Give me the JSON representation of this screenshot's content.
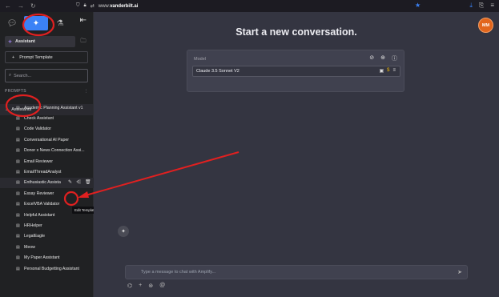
{
  "browser": {
    "url_prefix": "www.",
    "url_domain": "vanderbilt.ai"
  },
  "sidebar": {
    "assistant_label": "Assistant",
    "prompt_template_label": "Prompt Template",
    "search_placeholder": "Search...",
    "prompts_header": "PROMPTS",
    "folder_name": "Assistants",
    "items": [
      "Academic Planning Assistant v1",
      "Check Assistant",
      "Code Validator",
      "Conversational AI Paper",
      "Donor x News Connection Assi...",
      "Email Reviewer",
      "EmailThreadAnalyst",
      "Enthusiastic Assista",
      "Essay Reviewer",
      "ExcelVBA Validator",
      "Helpful Assistant",
      "HRHelper",
      "LegalEagle",
      "Meow",
      "My Paper Assistant",
      "Personal Budgetting Assistant"
    ],
    "tooltip": "Edit Template"
  },
  "main": {
    "title": "Start a new conversation.",
    "avatar": "MM",
    "model_label": "Model",
    "model_value": "Claude 3.5 Sonnet V2",
    "chat_placeholder": "Type a message to chat with Amplify..."
  },
  "colors": {
    "accent": "#3b82f6",
    "annotation": "#e02020",
    "avatar": "#e2661c"
  }
}
